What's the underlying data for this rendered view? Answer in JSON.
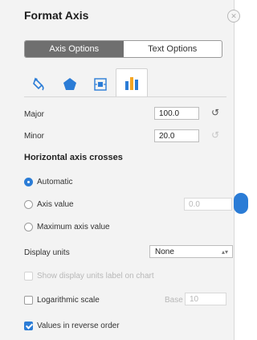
{
  "panel": {
    "title": "Format Axis",
    "close_glyph": "✕",
    "tabs": [
      "Axis Options",
      "Text Options"
    ],
    "icons": [
      "paint-bucket-icon",
      "pentagon-icon",
      "size-properties-icon",
      "bar-chart-icon"
    ],
    "accent": "#2b7cd6"
  },
  "units": {
    "major_label": "Major",
    "major_value": "100.0",
    "minor_label": "Minor",
    "minor_value": "20.0",
    "reset_glyph": "↺"
  },
  "crosses": {
    "heading": "Horizontal axis crosses",
    "automatic": "Automatic",
    "axis_value": "Axis value",
    "axis_value_input": "0.0",
    "maximum": "Maximum axis value"
  },
  "display": {
    "label": "Display units",
    "selected": "None",
    "show_label": "Show display units label on chart"
  },
  "log": {
    "label": "Logarithmic scale",
    "base_label": "Base",
    "base_value": "10"
  },
  "reverse": {
    "label": "Values in reverse order"
  }
}
